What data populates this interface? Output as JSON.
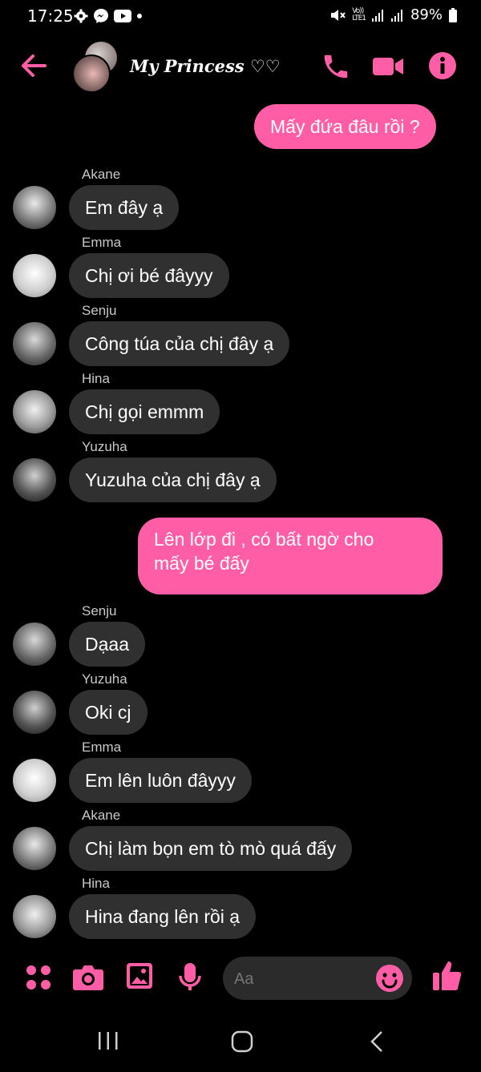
{
  "status_bar": {
    "time": "17:25",
    "battery": "89%",
    "network": "LTE1",
    "volte": "Vo))"
  },
  "header": {
    "title": "My Princess ♡♡"
  },
  "messages": [
    {
      "type": "out",
      "text": "Mấy đứa đâu rồi ?"
    },
    {
      "type": "in",
      "sender": "Akane",
      "text": "Em đây ạ"
    },
    {
      "type": "in",
      "sender": "Emma",
      "text": "Chị ơi bé đâyyy"
    },
    {
      "type": "in",
      "sender": "Senju",
      "text": "Công túa của chị đây ạ"
    },
    {
      "type": "in",
      "sender": "Hina",
      "text": "Chị gọi emmm"
    },
    {
      "type": "in",
      "sender": "Yuzuha",
      "text": "Yuzuha của chị đây ạ"
    },
    {
      "type": "out",
      "text_line1": "Lên lớp đi , có bất ngờ cho",
      "text_line2": "mấy bé đấy"
    },
    {
      "type": "in",
      "sender": "Senju",
      "text": "Dạaa"
    },
    {
      "type": "in",
      "sender": "Yuzuha",
      "text": "Oki cj"
    },
    {
      "type": "in",
      "sender": "Emma",
      "text": "Em lên luôn đâyyy"
    },
    {
      "type": "in",
      "sender": "Akane",
      "text": "Chị làm bọn em tò mò quá đấy"
    },
    {
      "type": "in",
      "sender": "Hina",
      "text": "Hina đang lên rồi ạ"
    }
  ],
  "composer": {
    "placeholder": "Aa"
  },
  "colors": {
    "accent": "#ff5ea6",
    "incoming_bubble": "#303030",
    "background": "#000000"
  }
}
